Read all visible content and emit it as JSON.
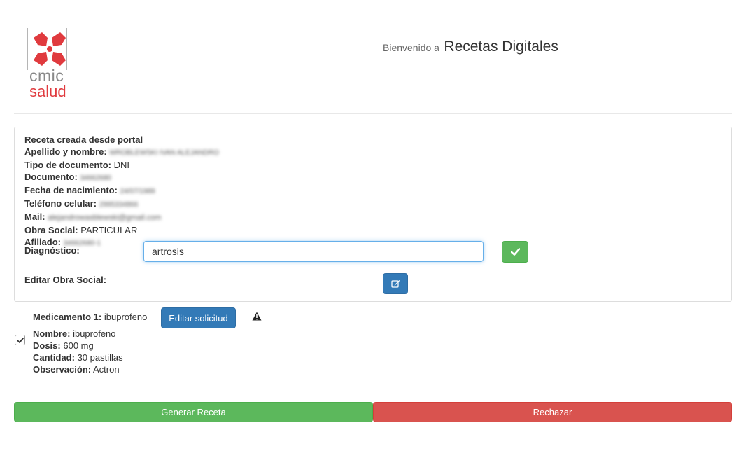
{
  "header": {
    "logo_top": "cmic",
    "logo_bottom": "salud",
    "welcome_prefix": "Bienvenido a",
    "app_title": "Recetas Digitales"
  },
  "patient": {
    "origin": "Receta creada desde portal",
    "fields": [
      {
        "label": "Apellido y nombre:",
        "value": "WROBLEWSKI IVAN ALEJANDRO",
        "redacted": true
      },
      {
        "label": "Tipo de documento:",
        "value": "DNI",
        "redacted": false
      },
      {
        "label": "Documento:",
        "value": "34662680",
        "redacted": true
      },
      {
        "label": "Fecha de nacimiento:",
        "value": "24/07/1989",
        "redacted": true
      },
      {
        "label": "Teléfono celular:",
        "value": "2995334866",
        "redacted": true
      },
      {
        "label": "Mail:",
        "value": "alejandrowasblewski@gmail.com",
        "redacted": true
      },
      {
        "label": "Obra Social:",
        "value": "PARTICULAR",
        "redacted": false
      },
      {
        "label": "Afiliado:",
        "value": "34662680-1",
        "redacted": true
      }
    ]
  },
  "diagnosis": {
    "label": "Diagnóstico:",
    "value": "artrosis"
  },
  "edit_obra_social": {
    "label": "Editar Obra Social:"
  },
  "medication": {
    "header_label": "Medicamento 1:",
    "header_value": "ibuprofeno",
    "edit_button": "Editar solicitud",
    "checked": true,
    "details": [
      {
        "label": "Nombre:",
        "value": "ibuprofeno"
      },
      {
        "label": "Dosis:",
        "value": "600 mg"
      },
      {
        "label": "Cantidad:",
        "value": "30 pastillas"
      },
      {
        "label": "Observación:",
        "value": "Actron"
      }
    ]
  },
  "actions": {
    "generate": "Generar Receta",
    "reject": "Rechazar"
  },
  "colors": {
    "success": "#5cb85c",
    "danger": "#d9534f",
    "primary": "#337ab7",
    "brand_red": "#e03a3e"
  },
  "icons": {
    "confirm": "check-icon",
    "edit": "edit-icon",
    "warning": "warning-icon",
    "checkbox": "checkmark-icon"
  }
}
